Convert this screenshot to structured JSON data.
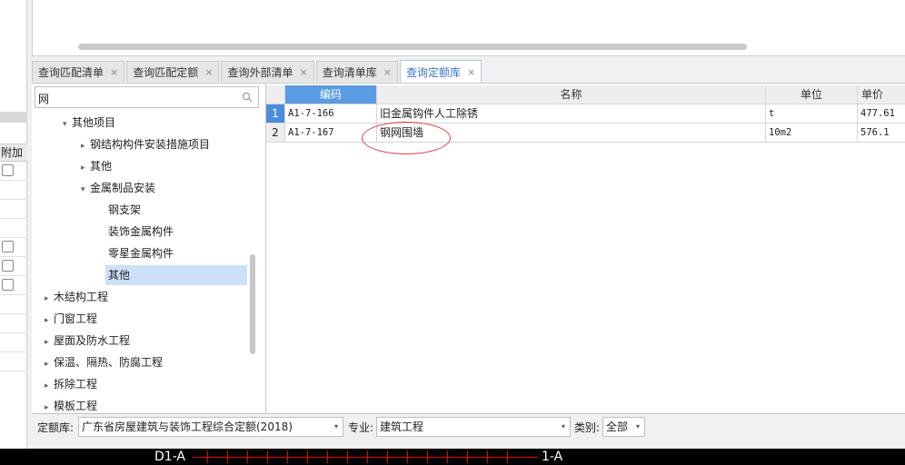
{
  "tabs": [
    {
      "label": "查询匹配清单",
      "active": false
    },
    {
      "label": "查询匹配定额",
      "active": false
    },
    {
      "label": "查询外部清单",
      "active": false
    },
    {
      "label": "查询清单库",
      "active": false
    },
    {
      "label": "查询定额库",
      "active": true
    }
  ],
  "tab_close_glyph": "×",
  "left_sliver": {
    "header": "附加"
  },
  "search": {
    "value": "网"
  },
  "tree": {
    "items": [
      {
        "label": "其他项目",
        "arrow": "▾"
      },
      {
        "label": "钢结构构件安装措施项目",
        "arrow": "▸"
      },
      {
        "label": "其他",
        "arrow": "▸"
      },
      {
        "label": "金属制品安装",
        "arrow": "▾"
      },
      {
        "label": "钢支架",
        "arrow": ""
      },
      {
        "label": "装饰金属构件",
        "arrow": ""
      },
      {
        "label": "零星金属构件",
        "arrow": ""
      },
      {
        "label": "其他",
        "arrow": "",
        "selected": true
      },
      {
        "label": "木结构工程",
        "arrow": "▸"
      },
      {
        "label": "门窗工程",
        "arrow": "▸"
      },
      {
        "label": "屋面及防水工程",
        "arrow": "▸"
      },
      {
        "label": "保温、隔热、防腐工程",
        "arrow": "▸"
      },
      {
        "label": "拆除工程",
        "arrow": "▸"
      },
      {
        "label": "模板工程",
        "arrow": "▸"
      }
    ]
  },
  "grid": {
    "columns": [
      "编码",
      "名称",
      "单位",
      "单价"
    ],
    "rows": [
      {
        "num": "1",
        "code": "A1-7-166",
        "name": "旧金属钩件人工除锈",
        "unit": "t",
        "price": "477.61"
      },
      {
        "num": "2",
        "code": "A1-7-167",
        "name": "钢网围墙",
        "unit": "10m2",
        "price": "576.1"
      }
    ]
  },
  "bottom": {
    "quota_lib_label": "定额库:",
    "quota_lib_value": "广东省房屋建筑与装饰工程综合定额(2018)",
    "major_label": "专业:",
    "major_value": "建筑工程",
    "category_label": "类别:",
    "category_value": "全部",
    "caret": "▾"
  },
  "cad": {
    "left_label": "D1-A",
    "right_label": "1-A"
  },
  "colors": {
    "accent": "#5b9be3",
    "selection": "#cce1f7",
    "annotation": "#e23c3c"
  }
}
